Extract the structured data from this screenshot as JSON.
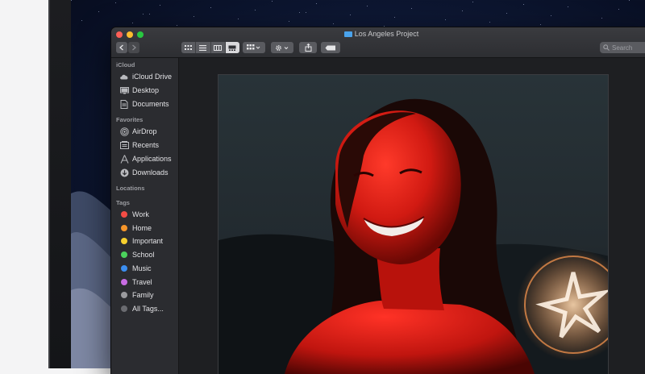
{
  "window": {
    "title": "Los Angeles Project",
    "search_placeholder": "Search"
  },
  "sidebar": {
    "sections": [
      {
        "header": "iCloud",
        "items": [
          {
            "label": "iCloud Drive",
            "icon": "cloud-icon"
          },
          {
            "label": "Desktop",
            "icon": "desktop-icon"
          },
          {
            "label": "Documents",
            "icon": "document-icon"
          }
        ]
      },
      {
        "header": "Favorites",
        "items": [
          {
            "label": "AirDrop",
            "icon": "airdrop-icon"
          },
          {
            "label": "Recents",
            "icon": "recents-icon"
          },
          {
            "label": "Applications",
            "icon": "applications-icon"
          },
          {
            "label": "Downloads",
            "icon": "downloads-icon"
          }
        ]
      },
      {
        "header": "Locations",
        "items": []
      },
      {
        "header": "Tags",
        "items": []
      }
    ],
    "tags": [
      {
        "label": "Work",
        "color": "#f24c45"
      },
      {
        "label": "Home",
        "color": "#f5952a"
      },
      {
        "label": "Important",
        "color": "#f7d02e"
      },
      {
        "label": "School",
        "color": "#4bd25c"
      },
      {
        "label": "Music",
        "color": "#3b8ef0"
      },
      {
        "label": "Travel",
        "color": "#c86ce3"
      },
      {
        "label": "Family",
        "color": "#9a9a9e"
      },
      {
        "label": "All Tags...",
        "color": "#6a6b70"
      }
    ]
  },
  "colors": {
    "traffic_close": "#fd5f57",
    "traffic_minimize": "#febc2e",
    "traffic_maximize": "#28c840",
    "folder_accent": "#4aa3ec"
  }
}
